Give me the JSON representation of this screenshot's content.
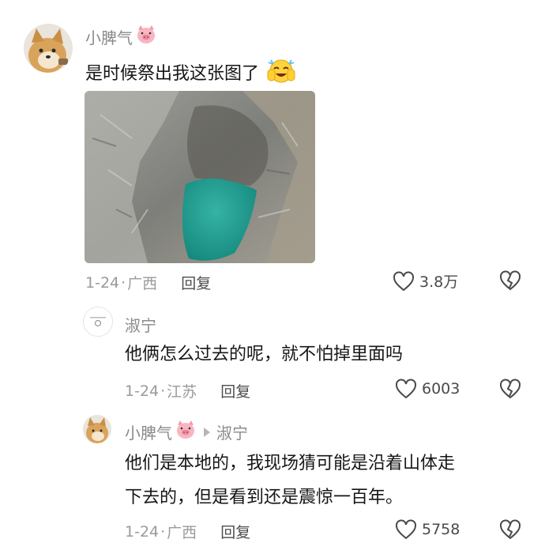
{
  "colors": {
    "text": "#161616",
    "meta": "#9a9a9a",
    "name": "#8a8a8a",
    "pool": "#2aa59a"
  },
  "comment1": {
    "username": "小脾气",
    "text": "是时候祭出我这张图了",
    "date": "1-24",
    "location": "广西",
    "reply_label": "回复",
    "likes": "3.8万",
    "emoji": "crying-laughing-emoji",
    "image_alt": "canyon-pool-photo"
  },
  "reply1": {
    "username": "淑宁",
    "text": "他俩怎么过去的呢，就不怕掉里面吗",
    "date": "1-24",
    "location": "江苏",
    "reply_label": "回复",
    "likes": "6003"
  },
  "reply2": {
    "username": "小脾气",
    "reply_to": "淑宁",
    "text_line1": "他们是本地的，我现场猜可能是沿着山体走",
    "text_line2": "下去的，但是看到还是震惊一百年。",
    "date": "1-24",
    "location": "广西",
    "reply_label": "回复",
    "likes": "5758"
  }
}
